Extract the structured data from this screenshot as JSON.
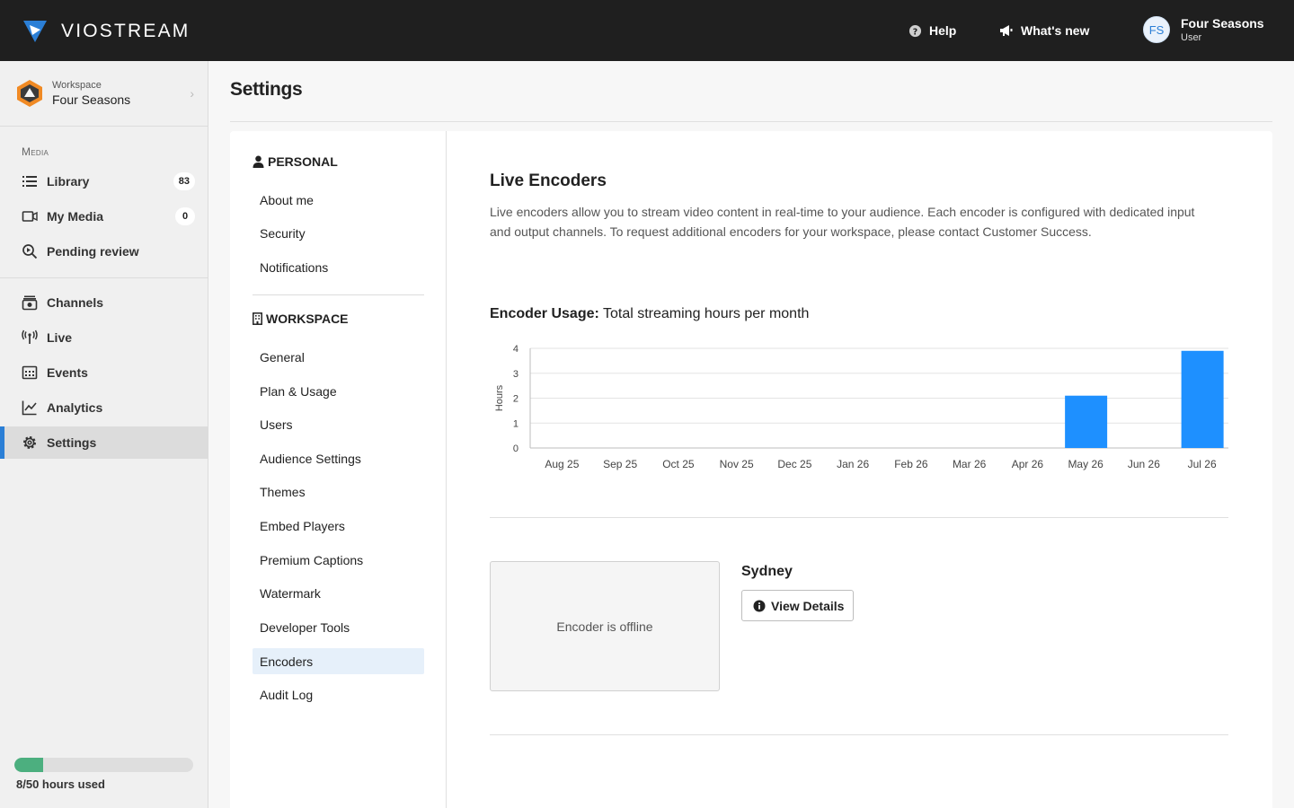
{
  "brand": {
    "name": "VIOSTREAM",
    "accent": "#2b7fd6",
    "topbar_bg": "#1f1f1f"
  },
  "header": {
    "help_label": "Help",
    "whats_new_label": "What's new",
    "user": {
      "initials": "FS",
      "name": "Four Seasons",
      "role": "User"
    }
  },
  "sidebar": {
    "workspace_label": "Workspace",
    "workspace_name": "Four Seasons",
    "section_media": "Media",
    "items": [
      {
        "label": "Library",
        "icon": "list-icon",
        "badge": "83"
      },
      {
        "label": "My Media",
        "icon": "media-icon",
        "badge": "0"
      },
      {
        "label": "Pending review",
        "icon": "review-icon"
      },
      {
        "label": "Channels",
        "icon": "channels-icon"
      },
      {
        "label": "Live",
        "icon": "live-icon"
      },
      {
        "label": "Events",
        "icon": "events-icon"
      },
      {
        "label": "Analytics",
        "icon": "analytics-icon"
      },
      {
        "label": "Settings",
        "icon": "gear-icon",
        "active": true
      }
    ],
    "usage": {
      "used": 8,
      "total": 50,
      "text": "8/50 hours used",
      "fraction": 0.16,
      "color": "#4caf7f"
    }
  },
  "page": {
    "title": "Settings"
  },
  "settings_nav": {
    "personal_heading": "PERSONAL",
    "personal": [
      "About me",
      "Security",
      "Notifications"
    ],
    "workspace_heading": "WORKSPACE",
    "workspace": [
      "General",
      "Plan & Usage",
      "Users",
      "Audience Settings",
      "Themes",
      "Embed Players",
      "Premium Captions",
      "Watermark",
      "Developer Tools",
      "Encoders",
      "Audit Log"
    ],
    "active": "Encoders"
  },
  "encoders": {
    "title": "Live Encoders",
    "description": "Live encoders allow you to stream video content in real-time to your audience. Each encoder is configured with dedicated input and output channels. To request additional encoders for your workspace, please contact Customer Success.",
    "usage_heading_bold": "Encoder Usage:",
    "usage_heading_rest": " Total streaming hours per month",
    "list": [
      {
        "name": "Sydney",
        "status": "Encoder is offline",
        "button": "View Details"
      }
    ]
  },
  "chart_data": {
    "type": "bar",
    "categories": [
      "Aug 25",
      "Sep 25",
      "Oct 25",
      "Nov 25",
      "Dec 25",
      "Jan 26",
      "Feb 26",
      "Mar 26",
      "Apr 26",
      "May 26",
      "Jun 26",
      "Jul 26"
    ],
    "values": [
      0,
      0,
      0,
      0,
      0,
      0,
      0,
      0,
      0,
      2.1,
      0,
      3.9
    ],
    "ylabel": "Hours",
    "ylim": [
      0,
      4
    ],
    "yticks": [
      0,
      1,
      2,
      3,
      4
    ],
    "grid": true,
    "bar_color": "#1e90ff"
  }
}
